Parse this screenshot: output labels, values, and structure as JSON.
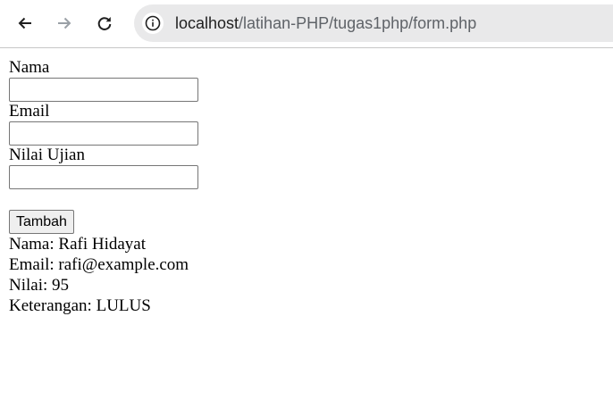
{
  "browser": {
    "url_host": "localhost",
    "url_path": "/latihan-PHP/tugas1php/form.php"
  },
  "form": {
    "nama_label": "Nama",
    "nama_value": "",
    "email_label": "Email",
    "email_value": "",
    "nilai_label": "Nilai Ujian",
    "nilai_value": "",
    "submit_label": "Tambah"
  },
  "result": {
    "nama": "Nama: Rafi Hidayat",
    "email": "Email: rafi@example.com",
    "nilai": "Nilai: 95",
    "keterangan": "Keterangan: LULUS"
  }
}
